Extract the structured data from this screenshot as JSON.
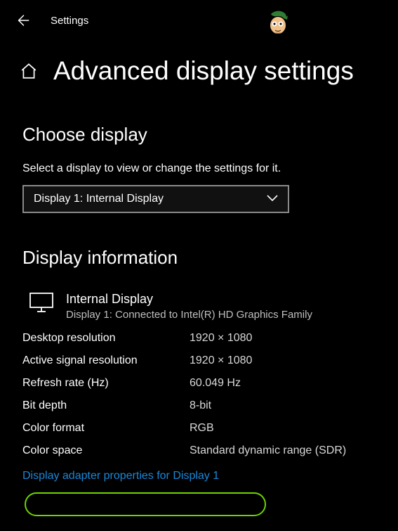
{
  "topbar": {
    "title": "Settings"
  },
  "page": {
    "title": "Advanced display settings"
  },
  "choose": {
    "heading": "Choose display",
    "helper": "Select a display to view or change the settings for it.",
    "selected": "Display 1: Internal Display"
  },
  "info": {
    "heading": "Display information",
    "title": "Internal Display",
    "subtitle": "Display 1: Connected to Intel(R) HD Graphics Family",
    "rows": [
      {
        "label": "Desktop resolution",
        "value": "1920 × 1080"
      },
      {
        "label": "Active signal resolution",
        "value": "1920 × 1080"
      },
      {
        "label": "Refresh rate (Hz)",
        "value": "60.049 Hz"
      },
      {
        "label": "Bit depth",
        "value": "8-bit"
      },
      {
        "label": "Color format",
        "value": "RGB"
      },
      {
        "label": "Color space",
        "value": "Standard dynamic range (SDR)"
      }
    ],
    "adapter_link": "Display adapter properties for Display 1"
  }
}
